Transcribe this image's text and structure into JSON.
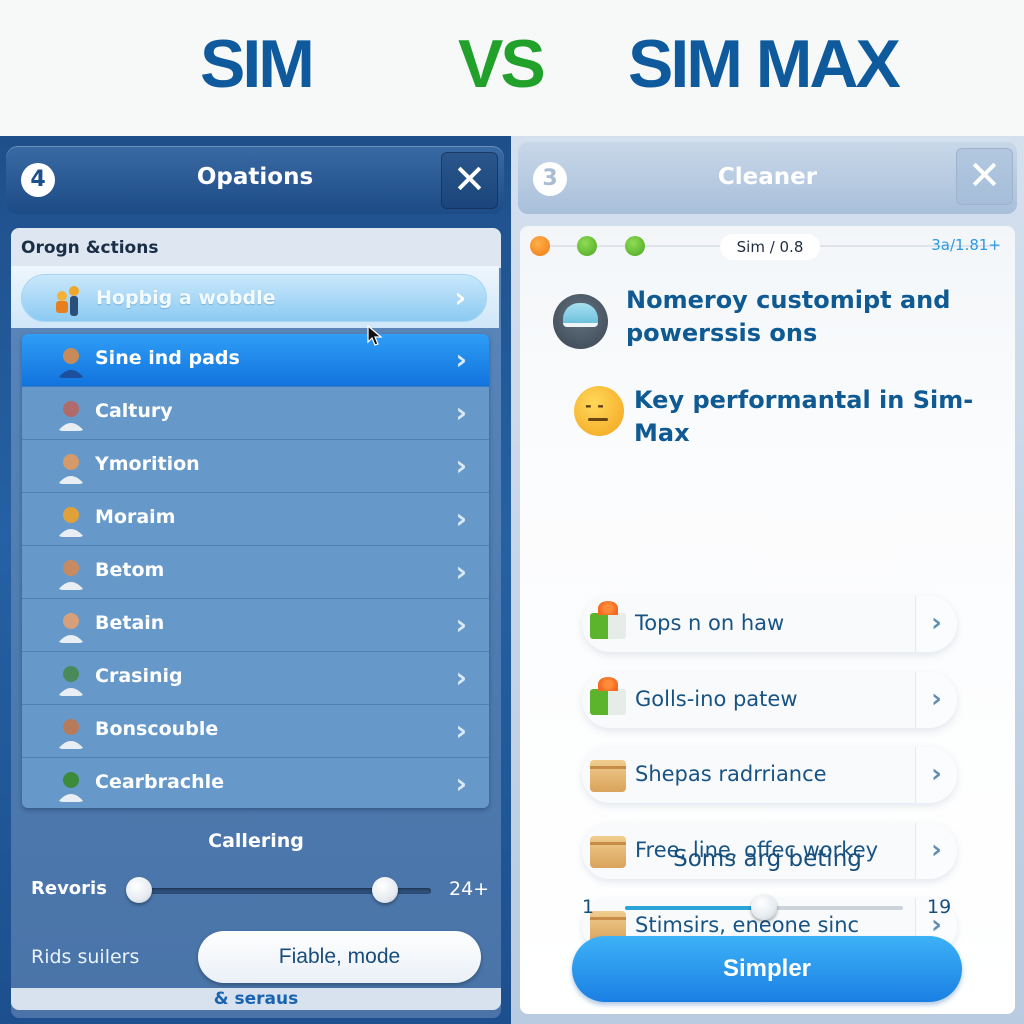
{
  "header": {
    "left_title": "SIM",
    "vs": "VS",
    "right_title": "SIM MAX"
  },
  "colors": {
    "brand_blue": "#0e5a9c",
    "vs_green": "#22a12a",
    "active_row": "#1273de",
    "primary_button": "#1a7fe3"
  },
  "left_panel": {
    "badge": "4",
    "title": "Opations",
    "close_icon": "close-icon",
    "section_heading": "Orogn &ctions",
    "highlighted_item": {
      "label": "Hopbig a wobdle",
      "icon": "people-icon"
    },
    "items": [
      {
        "label": "Sine ind pads",
        "icon": "avatar-man-icon",
        "active": true
      },
      {
        "label": "Caltury",
        "icon": "avatar-couple-icon",
        "active": false
      },
      {
        "label": "Ymorition",
        "icon": "avatar-woman-icon",
        "active": false
      },
      {
        "label": "Moraim",
        "icon": "avatar-lion-icon",
        "active": false
      },
      {
        "label": "Betom",
        "icon": "avatar-reclining-icon",
        "active": false
      },
      {
        "label": "Betain",
        "icon": "avatar-man-icon",
        "active": false
      },
      {
        "label": "Crasinig",
        "icon": "avatar-globe-icon",
        "active": false
      },
      {
        "label": "Bonscouble",
        "icon": "avatar-man-icon",
        "active": false
      },
      {
        "label": "Cearbrachle",
        "icon": "avatar-portrait-icon",
        "active": false
      }
    ],
    "calibration_title": "Callering",
    "range_slider": {
      "label": "Revoris",
      "low_fraction": 0.0,
      "high_fraction": 0.85,
      "value_text": "24+"
    },
    "mode_label": "Rids suilers",
    "mode_button": "Fiable, mode",
    "footer": "& seraus"
  },
  "right_panel": {
    "badge": "3",
    "title": "Cleaner",
    "close_icon": "close-icon",
    "progress": {
      "steps": [
        "orange",
        "green",
        "green"
      ],
      "pill": "Sim  / 0.8",
      "ratio": "3a/1.81+"
    },
    "feature_1": "Nomeroy customipt and powerssis ons",
    "feature_2": "Key performantal in Sim-Max",
    "options": [
      {
        "label": "Tops n on haw",
        "icon": "gift-icon"
      },
      {
        "label": "Golls-ino patew",
        "icon": "gift-icon"
      },
      {
        "label": "Shepas radrriance",
        "icon": "box-icon"
      },
      {
        "label": "Free, line, offec workey",
        "icon": "box-icon"
      },
      {
        "label": "Stimsirs, eneone sinc",
        "icon": "box-icon"
      }
    ],
    "slider": {
      "title": "Soms arg beting",
      "min": "1",
      "max": "19",
      "fraction": 0.5
    },
    "primary_button": "Simpler"
  }
}
